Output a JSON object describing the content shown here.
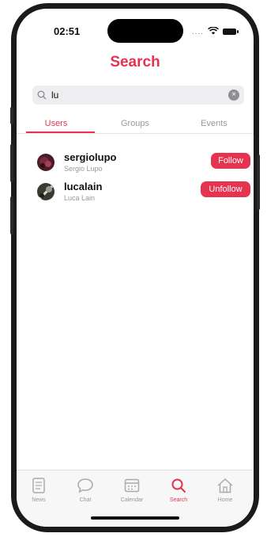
{
  "status_bar": {
    "time": "02:51",
    "signal_dots": "...."
  },
  "header": {
    "title": "Search"
  },
  "search": {
    "value": "lu"
  },
  "tabs": [
    {
      "label": "Users",
      "active": true
    },
    {
      "label": "Groups",
      "active": false
    },
    {
      "label": "Events",
      "active": false
    }
  ],
  "users": [
    {
      "username": "sergiolupo",
      "full_name": "Sergio Lupo",
      "action": "Follow"
    },
    {
      "username": "lucalain",
      "full_name": "Luca Lain",
      "action": "Unfollow"
    }
  ],
  "tab_bar": [
    {
      "label": "News",
      "icon": "news-icon"
    },
    {
      "label": "Chat",
      "icon": "chat-icon"
    },
    {
      "label": "Calendar",
      "icon": "calendar-icon"
    },
    {
      "label": "Search",
      "icon": "search-icon",
      "active": true
    },
    {
      "label": "Home",
      "icon": "home-icon"
    }
  ],
  "colors": {
    "accent": "#e53350",
    "inactive": "#999999"
  }
}
